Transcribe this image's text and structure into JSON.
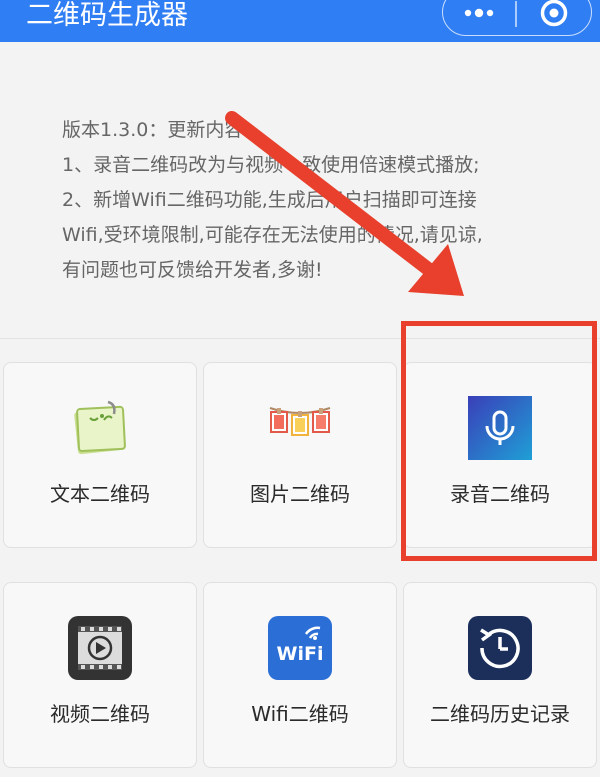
{
  "header": {
    "title": "二维码生成器",
    "more_icon": "more-dots-icon",
    "close_icon": "target-circle-icon",
    "bg_color": "#2f7ef4"
  },
  "notice": {
    "lines": [
      "版本1.3.0：更新内容：",
      "1、录音二维码改为与视频一致使用倍速模式播放;",
      "2、新增Wifi二维码功能,生成后用户扫描即可连接",
      "Wifi,受环境限制,可能存在无法使用的情况,请见谅,",
      "有问题也可反馈给开发者,多谢!"
    ]
  },
  "tiles": [
    {
      "label": "文本二维码",
      "icon": "text-note-icon"
    },
    {
      "label": "图片二维码",
      "icon": "photo-frames-icon"
    },
    {
      "label": "录音二维码",
      "icon": "microphone-icon"
    },
    {
      "label": "视频二维码",
      "icon": "video-film-icon"
    },
    {
      "label": "Wifi二维码",
      "icon": "wifi-icon",
      "icon_text": "WiFi"
    },
    {
      "label": "二维码历史记录",
      "icon": "history-clock-icon"
    }
  ],
  "annotation": {
    "color": "#e8402c",
    "highlighted_tile": "录音二维码"
  }
}
